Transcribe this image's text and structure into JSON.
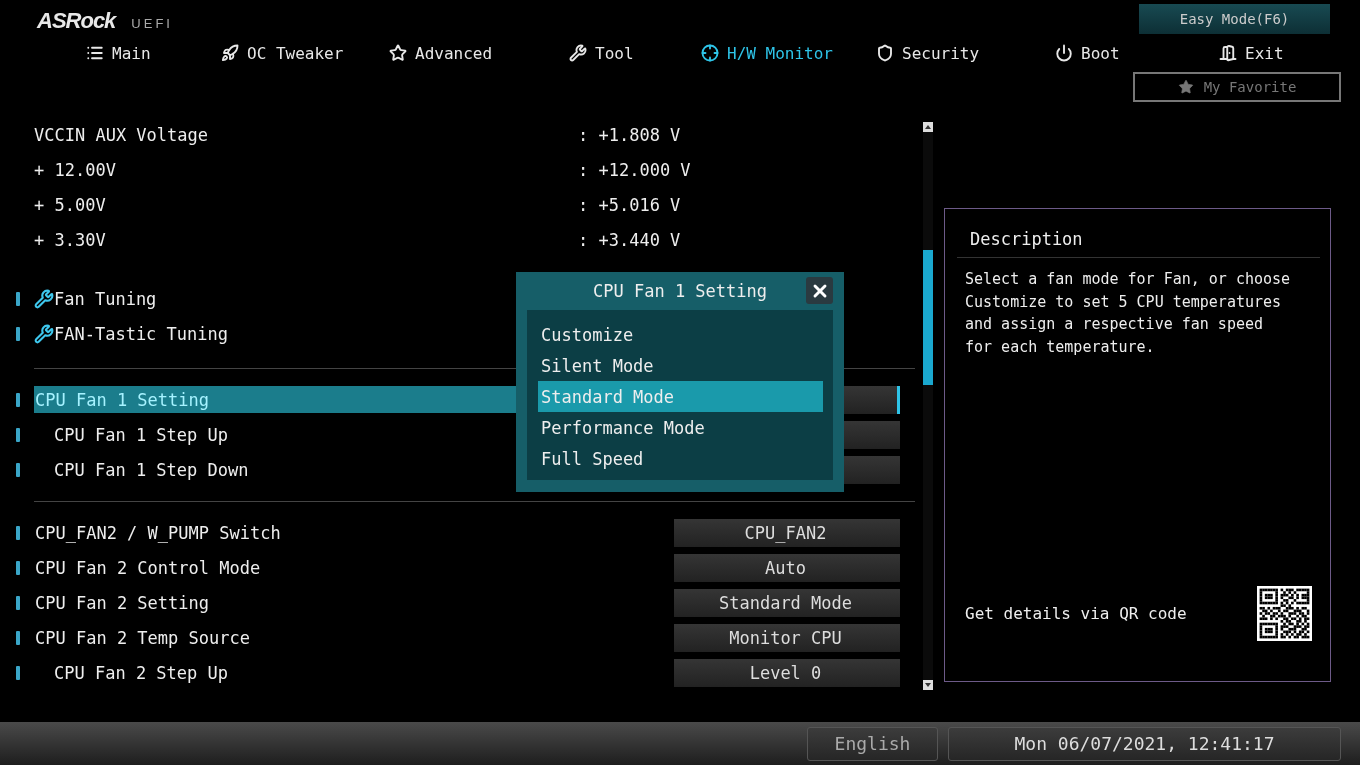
{
  "brand": {
    "logo": "ASRock",
    "sub": "UEFI"
  },
  "easy_mode": {
    "label": "Easy Mode(F6)"
  },
  "tabs": [
    {
      "label": "Main",
      "selected": false
    },
    {
      "label": "OC Tweaker",
      "selected": false
    },
    {
      "label": "Advanced",
      "selected": false
    },
    {
      "label": "Tool",
      "selected": false
    },
    {
      "label": "H/W Monitor",
      "selected": true
    },
    {
      "label": "Security",
      "selected": false
    },
    {
      "label": "Boot",
      "selected": false
    },
    {
      "label": "Exit",
      "selected": false
    }
  ],
  "my_favorite": {
    "label": "My Favorite"
  },
  "readings": [
    {
      "label": "VCCIN AUX Voltage",
      "value": ": +1.808 V"
    },
    {
      "label": "+ 12.00V",
      "value": ": +12.000 V"
    },
    {
      "label": "+ 5.00V",
      "value": ": +5.016 V"
    },
    {
      "label": "+ 3.30V",
      "value": ": +3.440 V"
    }
  ],
  "tools": [
    {
      "label": "Fan Tuning"
    },
    {
      "label": "FAN-Tastic Tuning"
    }
  ],
  "setting_groups": [
    {
      "items": [
        {
          "label": "CPU Fan 1 Setting",
          "selected": true,
          "children": [
            {
              "label": "CPU Fan 1 Step Up",
              "selected": false
            },
            {
              "label": "CPU Fan 1 Step Down",
              "selected": false
            }
          ]
        }
      ]
    },
    {
      "items": [
        {
          "label": "CPU_FAN2 / W_PUMP Switch",
          "value": "CPU_FAN2",
          "selected": false
        },
        {
          "label": "CPU Fan 2 Control Mode",
          "value": "Auto",
          "selected": false
        },
        {
          "label": "CPU Fan 2 Setting",
          "value": "Standard Mode",
          "selected": false
        },
        {
          "label": "CPU Fan 2 Temp Source",
          "value": "Monitor CPU",
          "selected": false,
          "children": [
            {
              "label": "CPU Fan 2 Step Up",
              "value": "Level 0",
              "selected": false
            }
          ]
        }
      ]
    }
  ],
  "popup": {
    "title": "CPU Fan 1 Setting",
    "options": [
      {
        "label": "Customize",
        "selected": false
      },
      {
        "label": "Silent Mode",
        "selected": false
      },
      {
        "label": "Standard Mode",
        "selected": true
      },
      {
        "label": "Performance Mode",
        "selected": false
      },
      {
        "label": "Full Speed",
        "selected": false
      }
    ]
  },
  "description": {
    "title": "Description",
    "text": "Select a fan mode for Fan, or choose Customize to set 5 CPU temperatures and assign a respective fan speed for each temperature.",
    "qr_caption": "Get details via QR code"
  },
  "footer": {
    "language": "English",
    "datetime": "Mon 06/07/2021, 12:41:17"
  }
}
